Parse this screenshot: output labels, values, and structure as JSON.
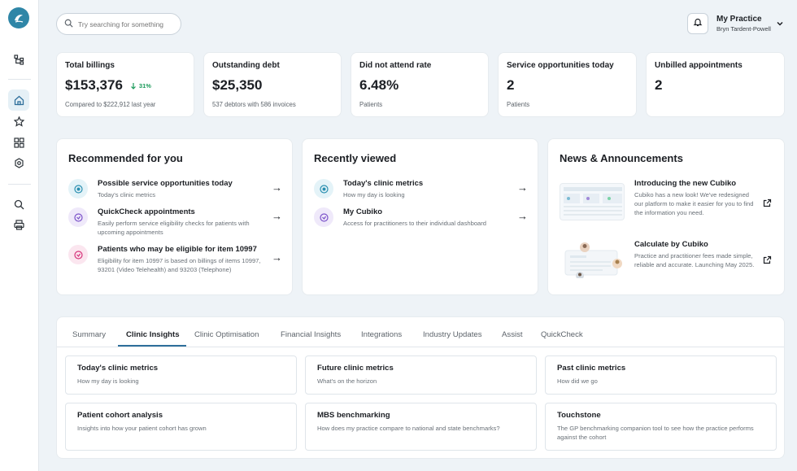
{
  "search": {
    "placeholder": "Try searching for something"
  },
  "user": {
    "practice": "My Practice",
    "name": "Bryn Tardent-Powell"
  },
  "stats": [
    {
      "title": "Total billings",
      "value": "$153,376",
      "delta": "31%",
      "sub": "Compared to $222,912 last year"
    },
    {
      "title": "Outstanding debt",
      "value": "$25,350",
      "sub": "537 debtors with 586 invoices"
    },
    {
      "title": "Did not attend rate",
      "value": "6.48%",
      "sub": "Patients"
    },
    {
      "title": "Service opportunities today",
      "value": "2",
      "sub": "Patients"
    },
    {
      "title": "Unbilled appointments",
      "value": "2",
      "sub": ""
    }
  ],
  "recommended": {
    "title": "Recommended for you",
    "items": [
      {
        "title": "Possible service opportunities today",
        "desc": "Today's clinic metrics"
      },
      {
        "title": "QuickCheck appointments",
        "desc": "Easily perform service eligibility checks for patients with upcoming appointments"
      },
      {
        "title": "Patients who may be eligible for item 10997",
        "desc": "Eligibility for item 10997 is based on billings of items 10997, 93201 (Video Telehealth) and 93203 (Telephone)"
      }
    ]
  },
  "recent": {
    "title": "Recently viewed",
    "items": [
      {
        "title": "Today's clinic metrics",
        "desc": "How my day is looking"
      },
      {
        "title": "My Cubiko",
        "desc": "Access for practitioners to their individual dashboard"
      }
    ]
  },
  "news": {
    "title": "News & Announcements",
    "items": [
      {
        "title": "Introducing the new Cubiko",
        "desc": "Cubiko has a new look! We've redesigned our platform to make it easier for you to find the information you need."
      },
      {
        "title": "Calculate by Cubiko",
        "desc": "Practice and practitioner fees made simple, reliable and accurate. Launching May 2025."
      }
    ]
  },
  "tabs": [
    "Summary",
    "Clinic Insights",
    "Clinic Optimisation",
    "Financial Insights",
    "Integrations",
    "Industry Updates",
    "Assist",
    "QuickCheck"
  ],
  "active_tab": "Clinic Insights",
  "metric_cards": [
    {
      "title": "Today's clinic metrics",
      "desc": "How my day is looking"
    },
    {
      "title": "Future clinic metrics",
      "desc": "What's on the horizon"
    },
    {
      "title": "Past clinic metrics",
      "desc": "How did we go"
    },
    {
      "title": "Patient cohort analysis",
      "desc": "Insights into how your patient cohort has grown"
    },
    {
      "title": "MBS benchmarking",
      "desc": "How does my practice compare to national and state benchmarks?"
    },
    {
      "title": "Touchstone",
      "desc": "The GP benchmarking companion tool to see how the practice performs against the cohort"
    }
  ],
  "colors": {
    "accent": "#2f6f9b",
    "positive": "#1a9a5a",
    "icon_teal": "#2a8fb0",
    "icon_purple": "#7b52c9",
    "icon_pink": "#d6337a"
  },
  "icons": {
    "sidebar": [
      "hierarchy-icon",
      "home-icon",
      "star-icon",
      "dashboard-icon",
      "settings-icon",
      "search-icon",
      "printer-icon"
    ],
    "stat_delta": "arrow-down-icon",
    "external": "external-link-icon"
  }
}
